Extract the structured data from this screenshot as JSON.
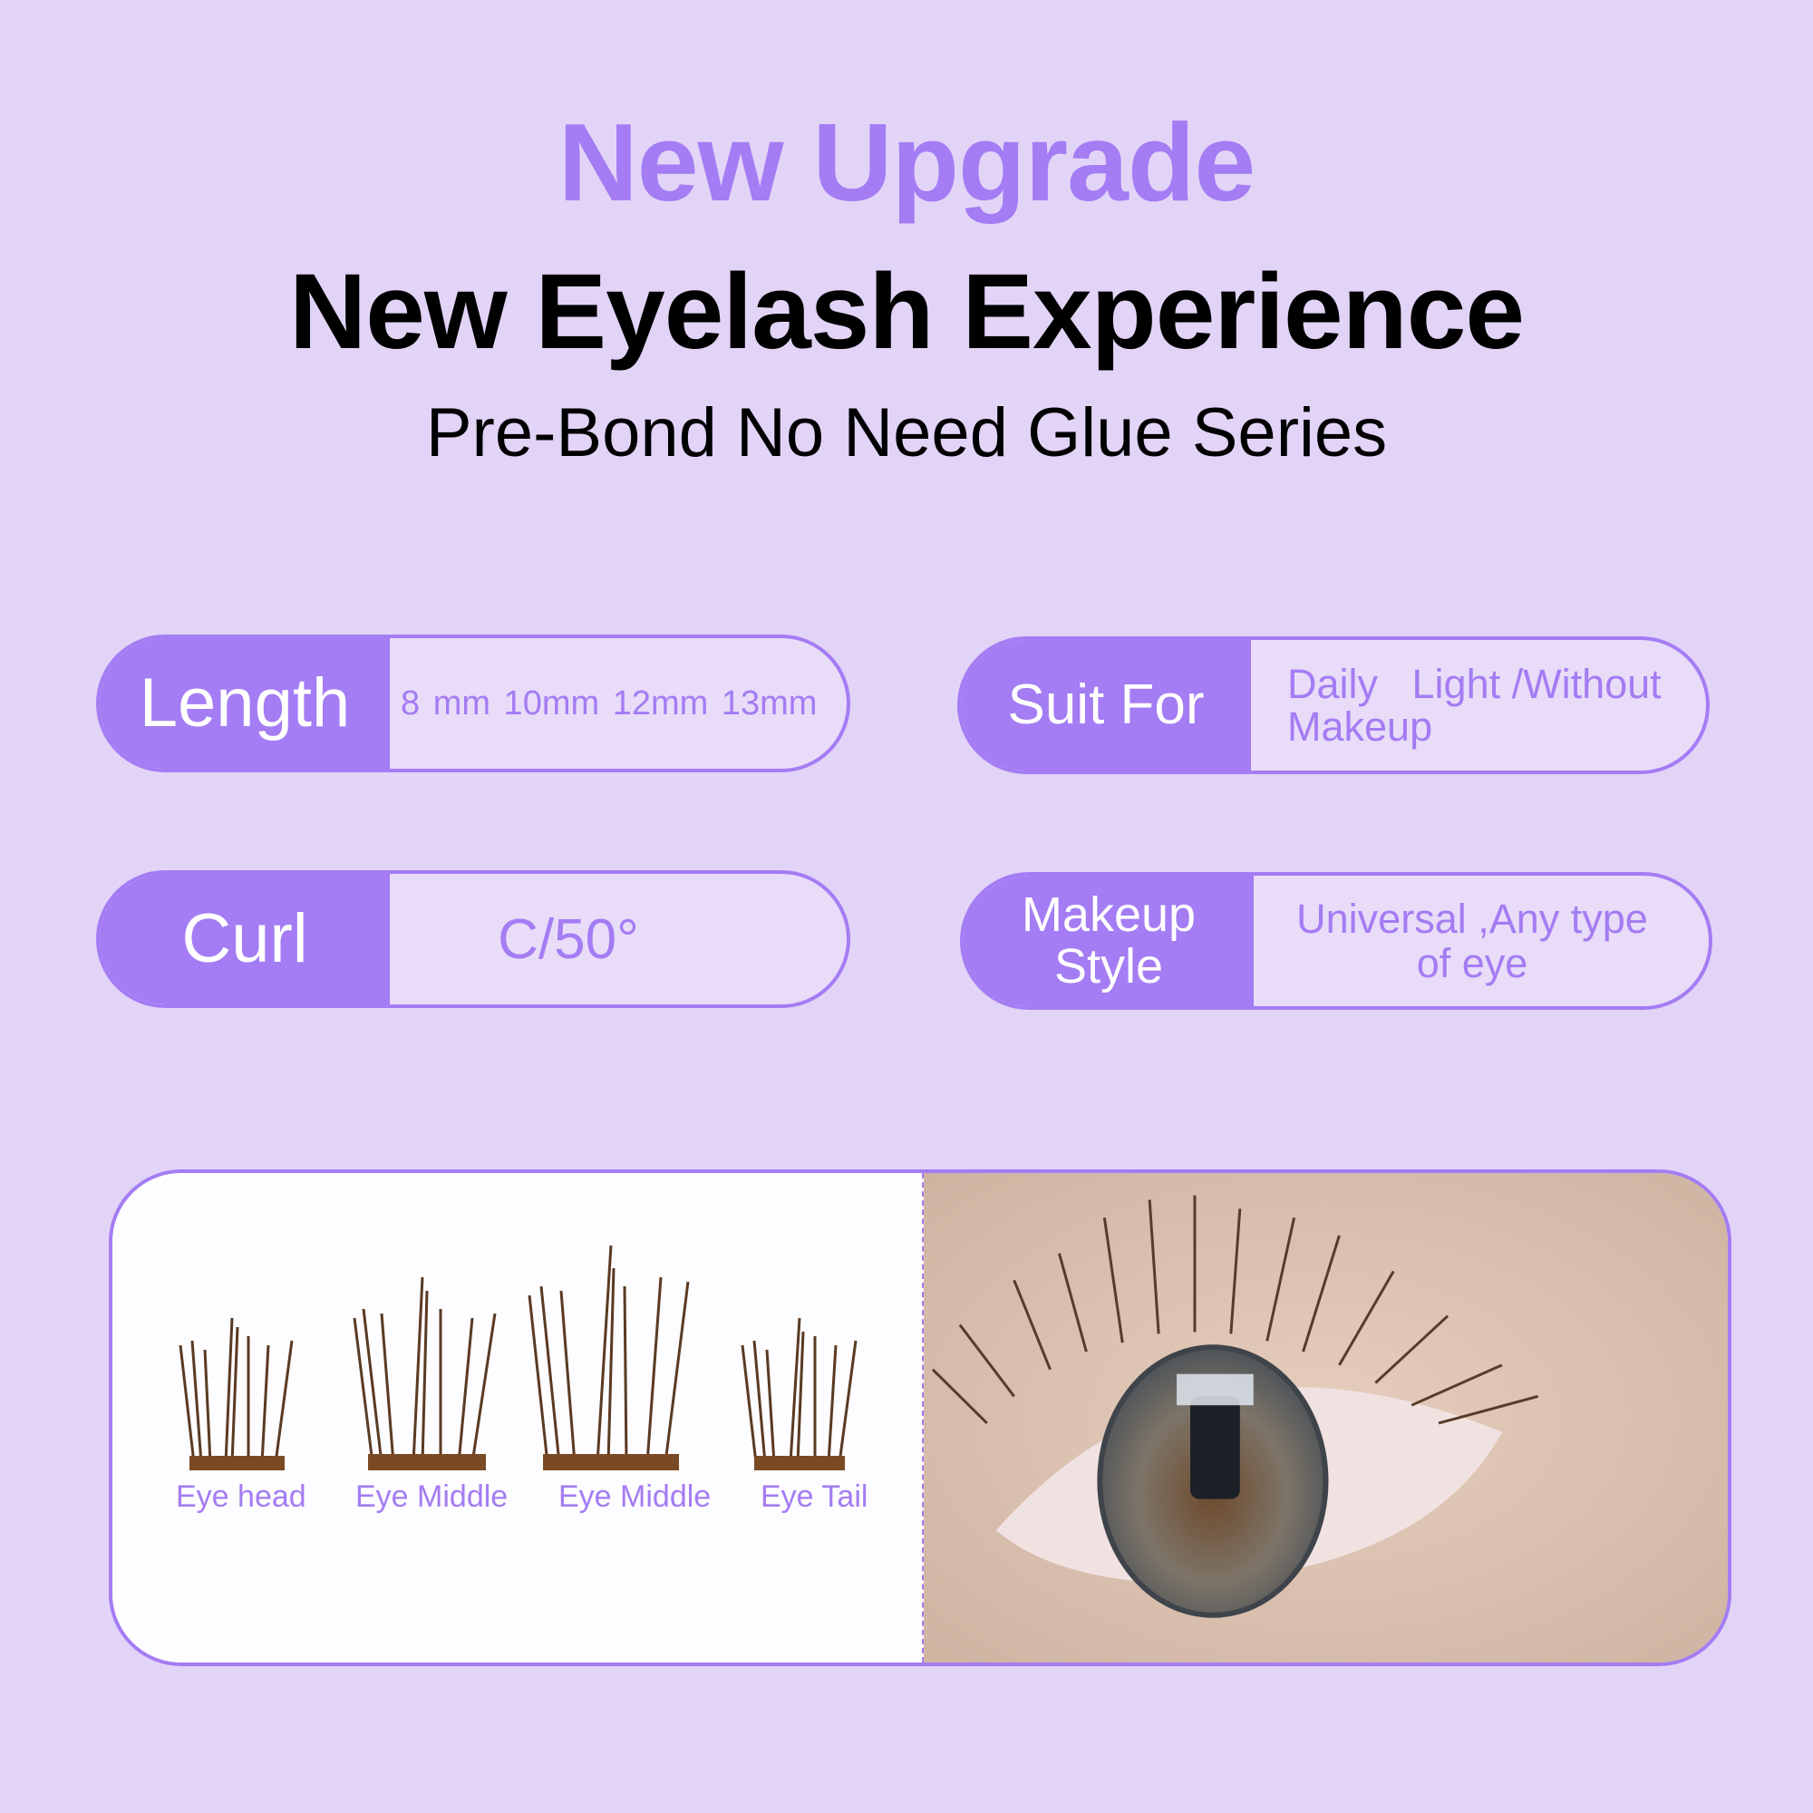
{
  "header": {
    "kicker": "New Upgrade",
    "title": "New Eyelash Experience",
    "subtitle": "Pre-Bond No Need Glue Series"
  },
  "specs": [
    {
      "label": "Length",
      "value": "8 mm  10mm  12mm  13mm"
    },
    {
      "label": "Suit For",
      "value_line1": "Daily   Light /Without",
      "value_line2": "Makeup"
    },
    {
      "label": "Curl",
      "value": "C/50°"
    },
    {
      "label_line1": "Makeup",
      "label_line2": "Style",
      "value_line1": "Universal ,Any type",
      "value_line2": "of eye"
    }
  ],
  "photos": {
    "lash_labels": [
      "Eye head",
      "Eye Middle",
      "Eye Middle",
      "Eye Tail"
    ],
    "lash_image": "lash-clusters-photo",
    "eye_image": "eye-closeup-photo"
  },
  "colors": {
    "accent": "#a47cf3",
    "background": "#e2d4f7",
    "pill_fill": "#e8dcf8"
  }
}
